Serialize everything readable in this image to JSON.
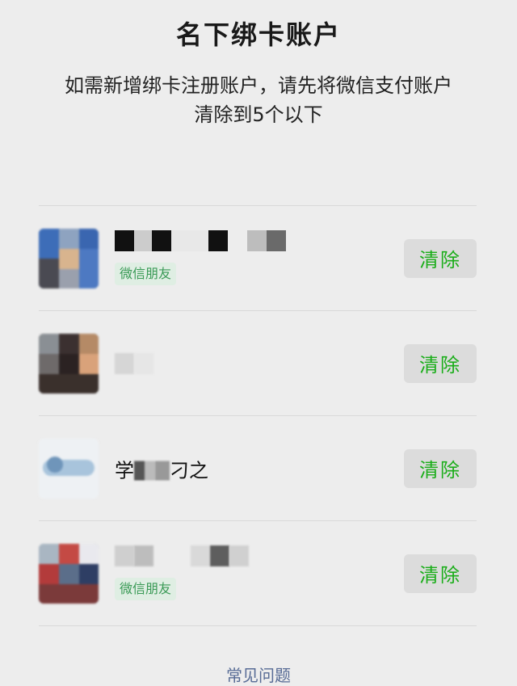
{
  "page": {
    "title": "名下绑卡账户",
    "description_line1": "如需新增绑卡注册账户，请先将微信支付账户",
    "description_line2": "清除到5个以下",
    "faq_link": "常见问题"
  },
  "accounts": [
    {
      "name": "",
      "tag": "微信朋友",
      "clear_label": "清除"
    },
    {
      "name": "",
      "tag": "",
      "clear_label": "清除"
    },
    {
      "name_prefix": "学",
      "name_suffix": "刁之",
      "tag": "",
      "clear_label": "清除"
    },
    {
      "name": "",
      "tag": "微信朋友",
      "clear_label": "清除"
    }
  ],
  "colors": {
    "background": "#ededed",
    "accent_green": "#1aad19",
    "tag_bg": "#dfeee3",
    "link": "#576b95"
  }
}
